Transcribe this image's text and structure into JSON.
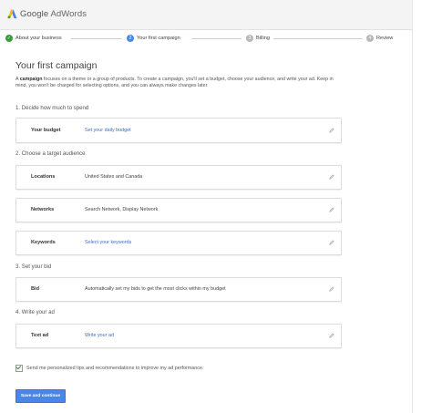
{
  "header": {
    "brand": "Google",
    "product": "AdWords",
    "logo_colors": {
      "blue": "#4285f4",
      "yellow": "#fbbc05"
    }
  },
  "stepper": {
    "steps": [
      {
        "label": "About your business",
        "state": "done",
        "marker": "✓"
      },
      {
        "label": "Your first campaign",
        "state": "active",
        "marker": "2"
      },
      {
        "label": "Billing",
        "state": "todo",
        "marker": "3"
      },
      {
        "label": "Review",
        "state": "todo",
        "marker": "4"
      }
    ]
  },
  "page": {
    "title": "Your first campaign",
    "intro_prefix": "A ",
    "intro_bold": "campaign",
    "intro_rest": " focuses on a theme or a group of products. To create a campaign, you'll set a budget, choose your audience, and write your ad. Keep in mind, you won't be charged for selecting options, and you can always make changes later."
  },
  "sections": {
    "budget_heading": "1. Decide how much to spend",
    "audience_heading": "2. Choose a target audience",
    "bid_heading": "3. Set your bid",
    "ad_heading": "4. Write your ad"
  },
  "rows": {
    "budget": {
      "label": "Your budget",
      "value": "Set your daily budget"
    },
    "locations": {
      "label": "Locations",
      "value": "United States and Canada"
    },
    "networks": {
      "label": "Networks",
      "value": "Search Network, Display Network"
    },
    "keywords": {
      "label": "Keywords",
      "value": "Select your keywords"
    },
    "bid": {
      "label": "Bid",
      "value": "Automatically set my bids to get the most clicks within my budget"
    },
    "text_ad": {
      "label": "Text ad",
      "value": "Write your ad"
    }
  },
  "tips_checkbox": {
    "label": "Send me personalized tips and recommendations to improve my ad performance.",
    "checked": true
  },
  "actions": {
    "save_label": "Save and continue"
  },
  "colors": {
    "accent": "#4a86e8",
    "link": "#3b6fc7",
    "done": "#3a9b3a"
  }
}
